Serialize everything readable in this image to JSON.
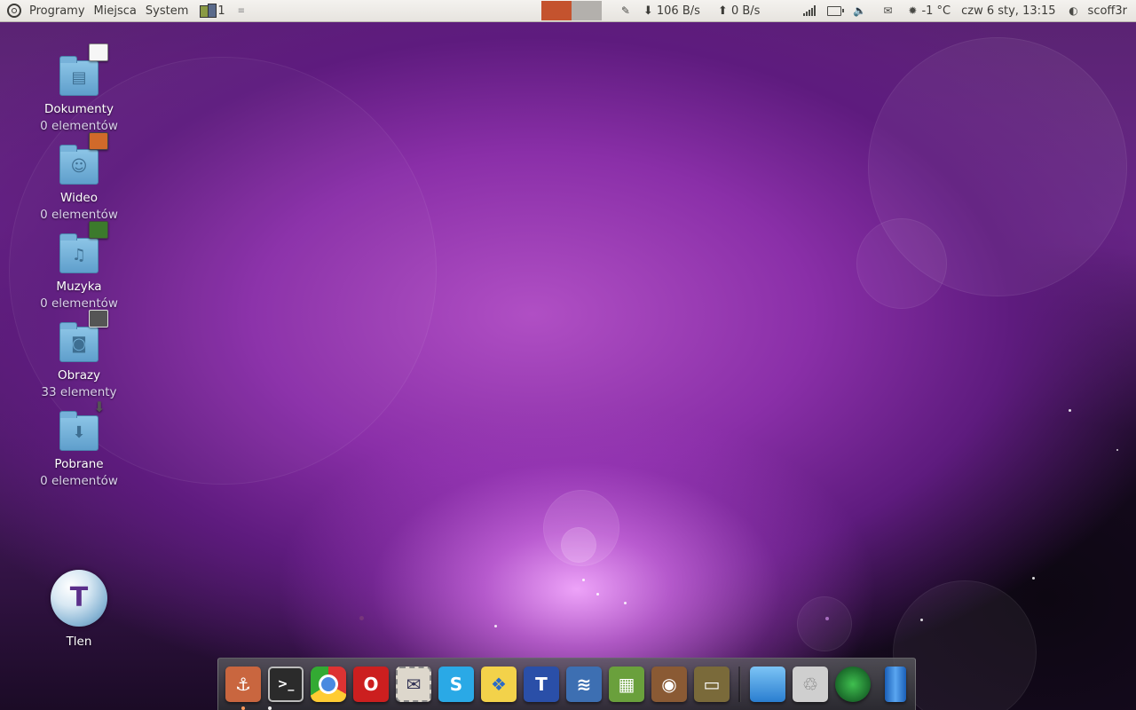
{
  "top_panel": {
    "menus": [
      "Programy",
      "Miejsca",
      "System"
    ],
    "workspace_number": "1",
    "net_down": "106 B/s",
    "net_up": "0 B/s",
    "weather": "-1 °C",
    "clock": "czw  6 sty, 13:15",
    "user": "scoff3r"
  },
  "desktop_icons": [
    {
      "label": "Dokumenty",
      "sub": "0 elementów",
      "icon": "documents-folder-icon"
    },
    {
      "label": "Wideo",
      "sub": "0 elementów",
      "icon": "video-folder-icon"
    },
    {
      "label": "Muzyka",
      "sub": "0 elementów",
      "icon": "music-folder-icon"
    },
    {
      "label": "Obrazy",
      "sub": "33 elementy",
      "icon": "pictures-folder-icon"
    },
    {
      "label": "Pobrane",
      "sub": "0 elementów",
      "icon": "downloads-folder-icon"
    },
    {
      "label": "Tlen",
      "icon": "tlen-icon"
    }
  ],
  "dock_items": [
    {
      "name": "anchor-launcher-icon",
      "color": "#c9663f"
    },
    {
      "name": "terminal-icon",
      "color": "#2b2b2b"
    },
    {
      "name": "chrome-icon",
      "color": "#e0e0e0"
    },
    {
      "name": "opera-icon",
      "color": "#cc1f1f"
    },
    {
      "name": "mail-stamp-icon",
      "color": "#ddd7cc"
    },
    {
      "name": "skype-icon",
      "color": "#2aa9e6"
    },
    {
      "name": "dropbox-icon",
      "color": "#f3d24a"
    },
    {
      "name": "text-editor-icon",
      "color": "#2a4fa8"
    },
    {
      "name": "office-writer-icon",
      "color": "#3d6fb2"
    },
    {
      "name": "office-calc-icon",
      "color": "#6aa03c"
    },
    {
      "name": "audio-speaker-icon",
      "color": "#8a5a34"
    },
    {
      "name": "tv-icon",
      "color": "#7a6a3a"
    },
    {
      "name": "desktop-show-icon",
      "color": "#3d8fd8"
    },
    {
      "name": "trash-icon",
      "color": "#cfcfcf"
    },
    {
      "name": "radar-icon",
      "color": "#2c8a3a"
    },
    {
      "name": "battery-icon",
      "color": "#2f7fd8"
    }
  ],
  "colors": {
    "panel_bg": "#e7e4df",
    "cpu_graph": "#c4532e",
    "mem_graph": "#b3b0ac",
    "wallpaper_accent": "#b04fc4"
  }
}
